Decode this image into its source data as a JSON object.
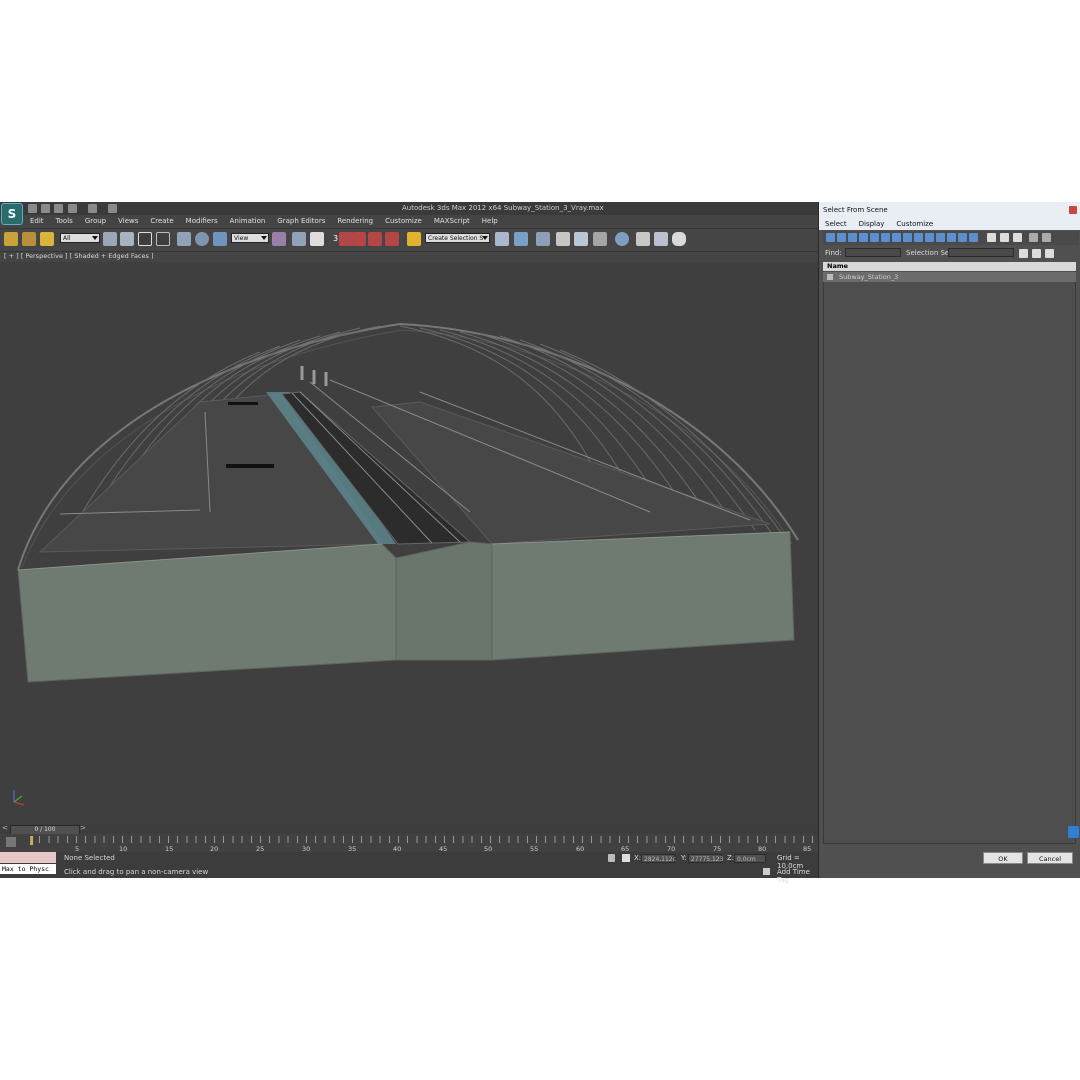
{
  "app": {
    "window_title": "Autodesk 3ds Max  2012 x64      Subway_Station_3_Vray.max",
    "logo_letter": "S",
    "menu": [
      "Edit",
      "Tools",
      "Group",
      "Views",
      "Create",
      "Modifiers",
      "Animation",
      "Graph Editors",
      "Rendering",
      "Customize",
      "MAXScript",
      "Help"
    ],
    "toolbar": {
      "selection_filter": "All",
      "reference_coord": "View",
      "named_selection": "Create Selection S",
      "snap_value": "3"
    },
    "viewport_label": "[ + ] [ Perspective ] [ Shaded + Edged Faces ]",
    "time_slider": "0 / 100",
    "ruler_ticks": [
      "5",
      "10",
      "15",
      "20",
      "25",
      "30",
      "35",
      "40",
      "45",
      "50",
      "55",
      "60",
      "65",
      "70",
      "75",
      "80",
      "85"
    ],
    "status": {
      "selection": "None Selected",
      "prompt": "Click and drag to pan a non-camera view",
      "x_label": "X:",
      "x_value": "2824,112c",
      "y_label": "Y:",
      "y_value": "27775,123",
      "z_label": "Z:",
      "z_value": "0,0cm",
      "grid": "Grid = 10,0cm",
      "add_time_tag": "Add Time Tag",
      "max_to_physc": "Max to Physc"
    }
  },
  "dialog": {
    "title": "Select From Scene",
    "menu": [
      "Select",
      "Display",
      "Customize"
    ],
    "find_label": "Find:",
    "selection_set_label": "Selection Set:",
    "column_name": "Name",
    "items": [
      "Subway_Station_3"
    ],
    "ok_label": "OK",
    "cancel_label": "Cancel"
  },
  "colors": {
    "ui_bg": "#444444",
    "viewport_bg": "#3f3f3f",
    "wall": "#6f7a70",
    "water": "#5f8f97"
  }
}
